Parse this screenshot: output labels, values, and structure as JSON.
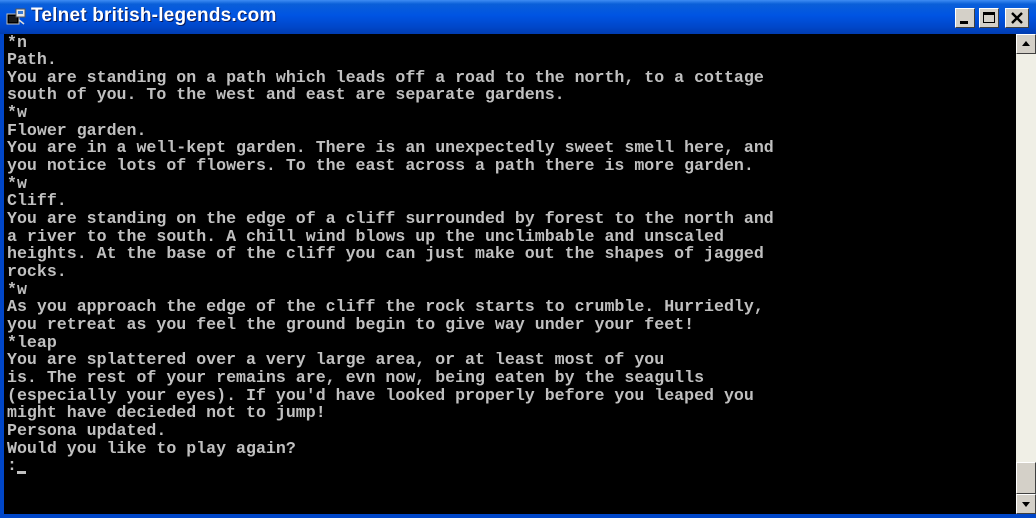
{
  "window": {
    "title": "Telnet british-legends.com"
  },
  "terminal": {
    "lines": [
      "*n",
      "Path.",
      "You are standing on a path which leads off a road to the north, to a cottage",
      "south of you. To the west and east are separate gardens.",
      "*w",
      "Flower garden.",
      "You are in a well-kept garden. There is an unexpectedly sweet smell here, and",
      "you notice lots of flowers. To the east across a path there is more garden.",
      "*w",
      "Cliff.",
      "You are standing on the edge of a cliff surrounded by forest to the north and",
      "a river to the south. A chill wind blows up the unclimbable and unscaled",
      "heights. At the base of the cliff you can just make out the shapes of jagged",
      "rocks.",
      "*w",
      "As you approach the edge of the cliff the rock starts to crumble. Hurriedly,",
      "you retreat as you feel the ground begin to give way under your feet!",
      "*leap",
      "You are splattered over a very large area, or at least most of you",
      "is. The rest of your remains are, evn now, being eaten by the seagulls",
      "(especially your eyes). If you'd have looked properly before you leaped you",
      "might have decieded not to jump!",
      "Persona updated.",
      "Would you like to play again?",
      ":"
    ]
  },
  "colors": {
    "terminal_bg": "#000000",
    "terminal_fg": "#c0c0c0",
    "titlebar": "#0054e3"
  },
  "icons": {
    "app": "telnet-app-icon",
    "minimize": "minimize-icon",
    "maximize": "maximize-icon",
    "close": "close-icon",
    "scroll_up": "arrow-up-icon",
    "scroll_down": "arrow-down-icon"
  }
}
